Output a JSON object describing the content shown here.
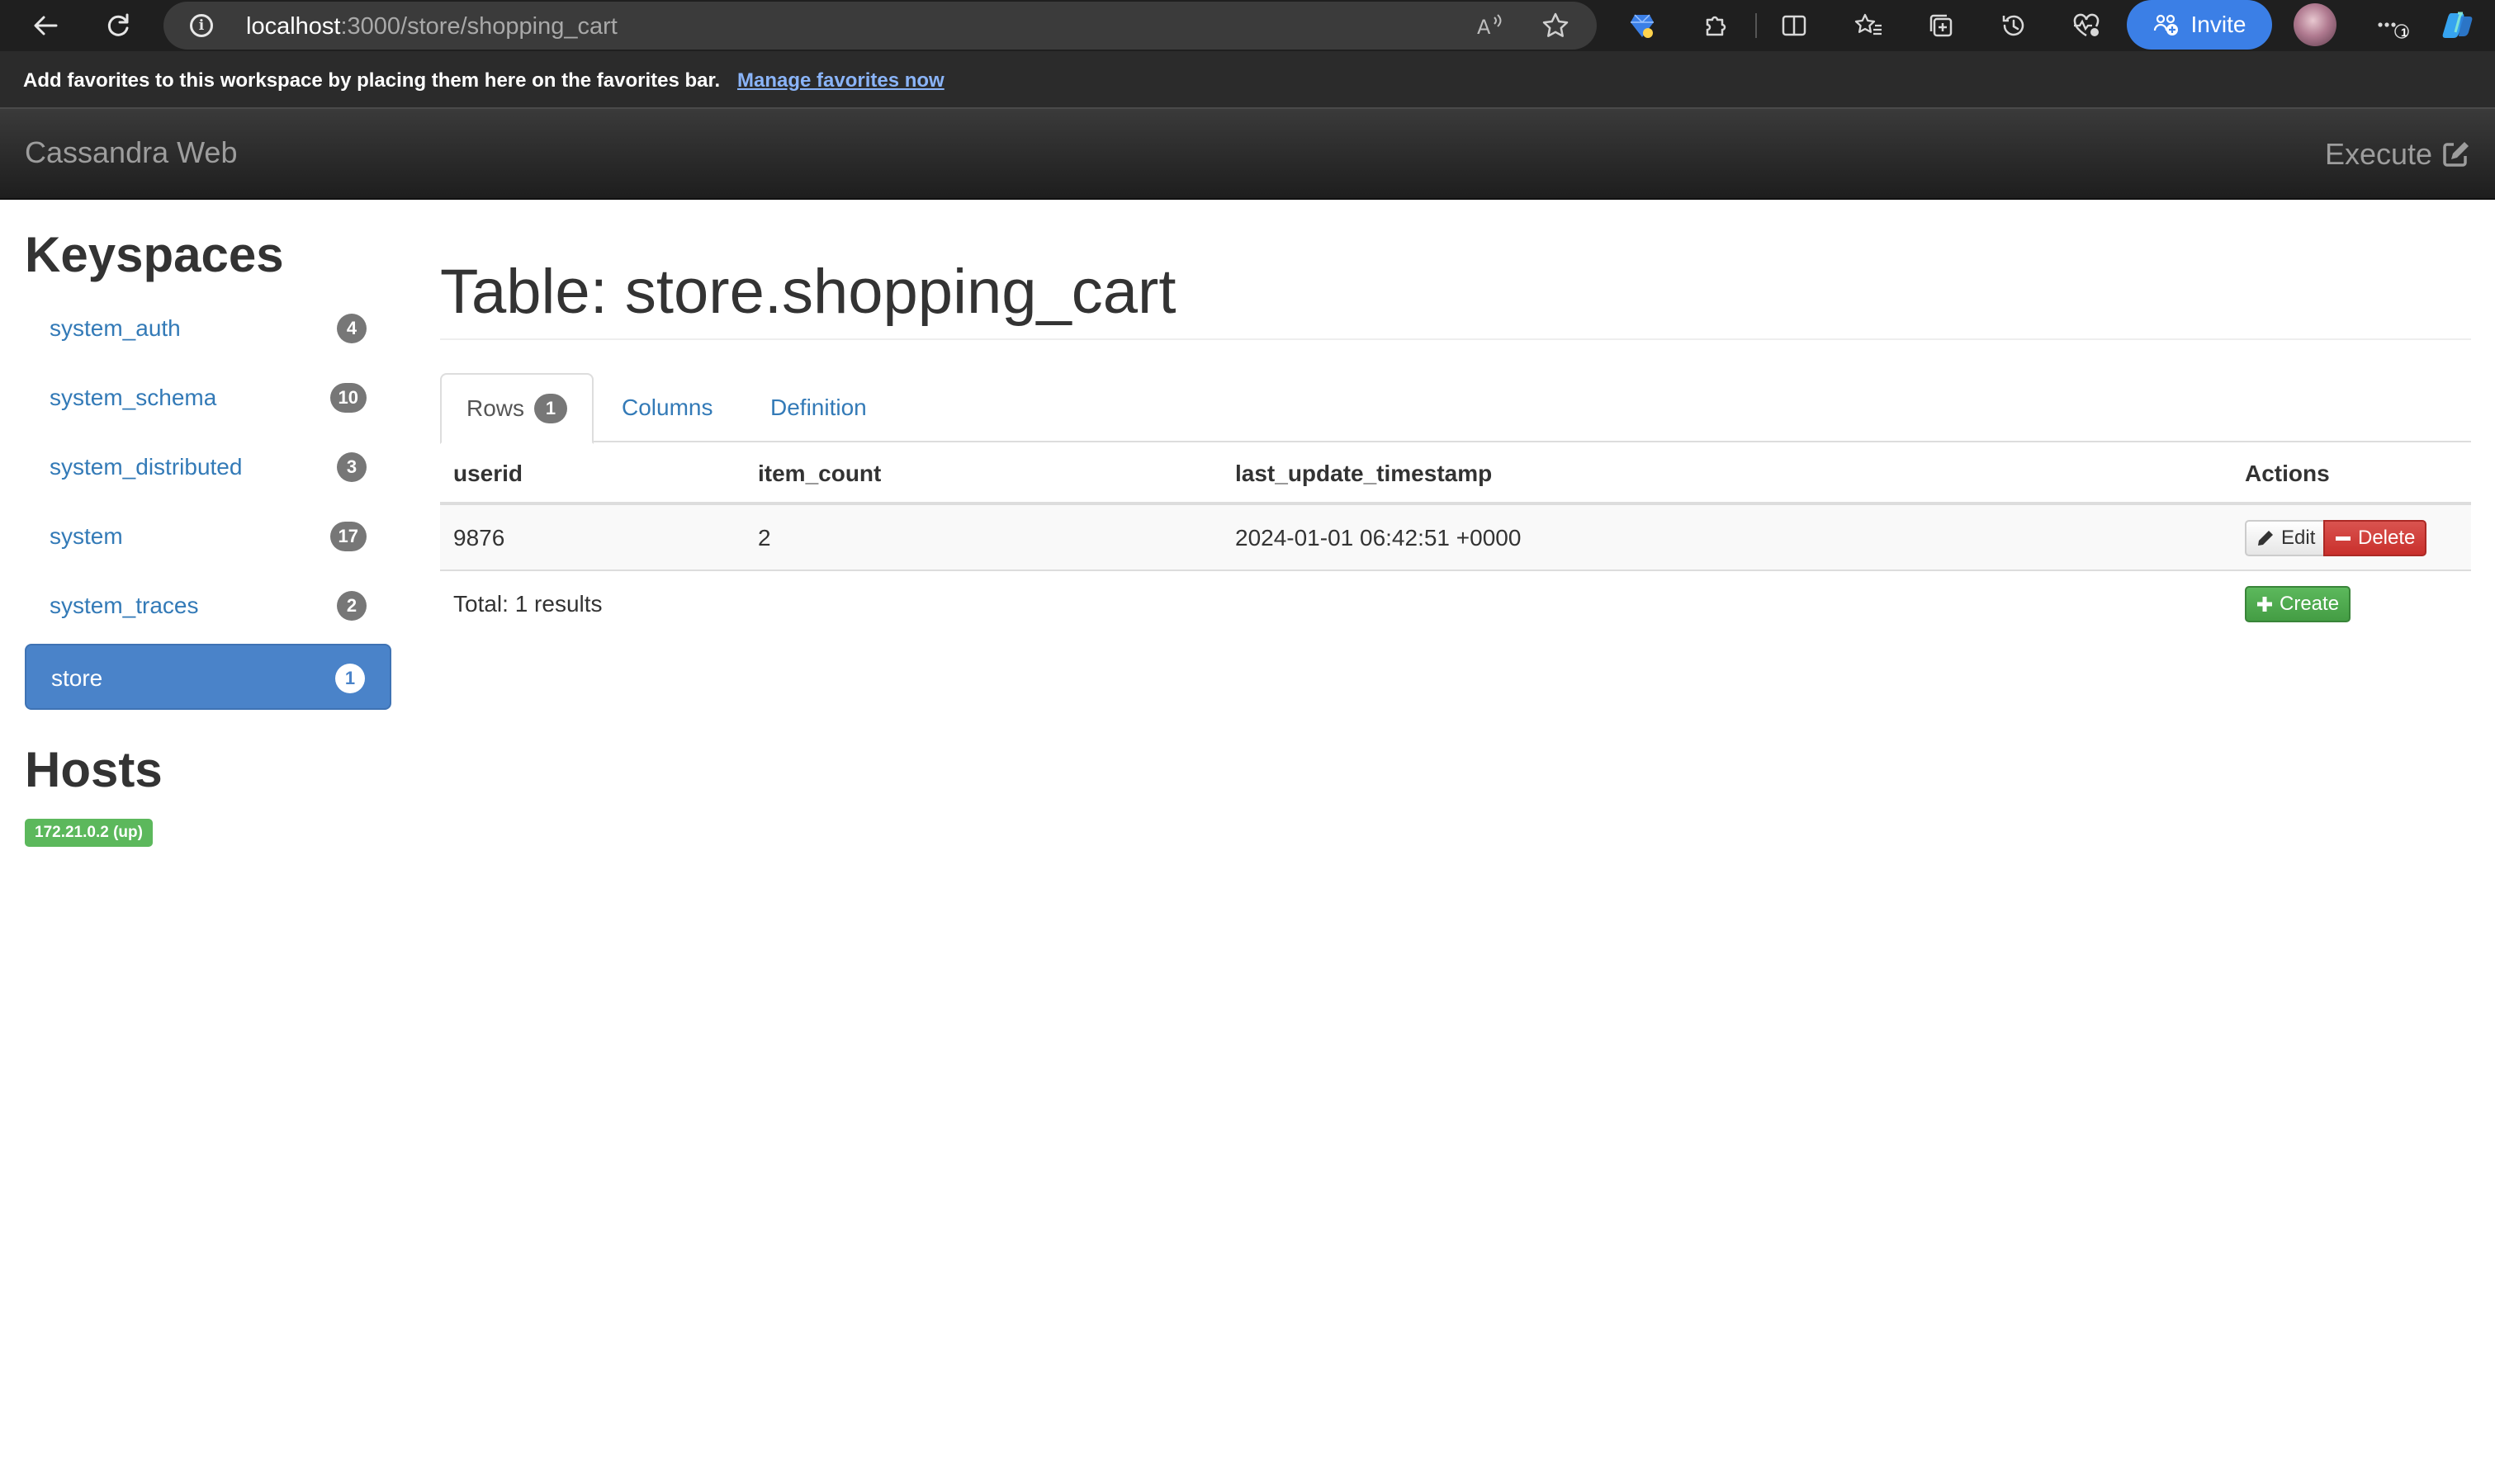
{
  "browser": {
    "url_host": "localhost",
    "url_path": ":3000/store/shopping_cart",
    "invite_label": "Invite",
    "more_badge": "1",
    "favorites_message": "Add favorites to this workspace by placing them here on the favorites bar.",
    "favorites_link": "Manage favorites now",
    "icons": [
      "back-icon",
      "refresh-icon",
      "info-icon",
      "read-aloud-icon",
      "favorite-star-icon",
      "gem-extension-icon",
      "extensions-icon",
      "split-screen-icon",
      "favorites-icon",
      "collections-icon",
      "history-icon",
      "performance-icon",
      "invite-people-icon",
      "more-icon",
      "copilot-icon"
    ]
  },
  "navbar": {
    "brand": "Cassandra Web",
    "execute_label": "Execute"
  },
  "sidebar": {
    "keyspaces_title": "Keyspaces",
    "keyspaces": [
      {
        "name": "system_auth",
        "count": "4"
      },
      {
        "name": "system_schema",
        "count": "10"
      },
      {
        "name": "system_distributed",
        "count": "3"
      },
      {
        "name": "system",
        "count": "17"
      },
      {
        "name": "system_traces",
        "count": "2"
      },
      {
        "name": "store",
        "count": "1",
        "active": true
      }
    ],
    "hosts_title": "Hosts",
    "hosts": [
      "172.21.0.2 (up)"
    ]
  },
  "main": {
    "title": "Table: store.shopping_cart",
    "tabs": [
      {
        "label": "Rows",
        "badge": "1",
        "active": true
      },
      {
        "label": "Columns"
      },
      {
        "label": "Definition"
      }
    ],
    "columns": [
      "userid",
      "item_count",
      "last_update_timestamp",
      "Actions"
    ],
    "rows": [
      {
        "userid": "9876",
        "item_count": "2",
        "last_update_timestamp": "2024-01-01 06:42:51 +0000"
      }
    ],
    "edit_label": "Edit",
    "delete_label": "Delete",
    "create_label": "Create",
    "total_text": "Total: 1 results"
  },
  "colors": {
    "accent": "#337ab7",
    "active_keyspace": "#4a83c9",
    "host_up": "#5cb85c",
    "delete": "#d9534f",
    "create": "#5cb85c",
    "browser_invite": "#3b7fe6"
  }
}
